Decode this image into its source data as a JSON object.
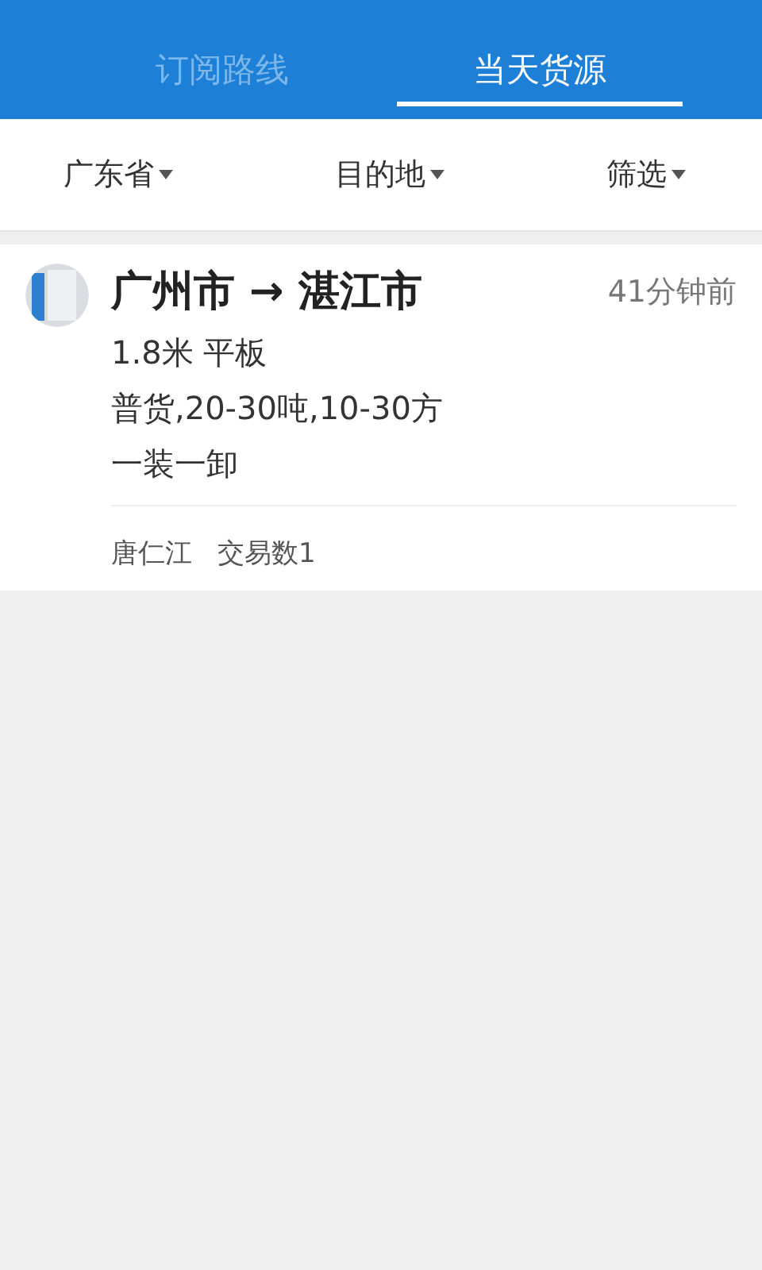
{
  "tabs": [
    {
      "label": "订阅路线",
      "selected": false
    },
    {
      "label": "当天货源",
      "selected": true
    }
  ],
  "filters": [
    {
      "label": "广东省"
    },
    {
      "label": "目的地"
    },
    {
      "label": "筛选"
    }
  ],
  "listings": [
    {
      "route": "广州市 → 湛江市",
      "time": "41分钟前",
      "vehicle": "1.8米 平板",
      "cargo": "普货,20-30吨,10-30方",
      "handling": "一装一卸",
      "shipper": "唐仁江",
      "trades": "交易数1"
    }
  ]
}
